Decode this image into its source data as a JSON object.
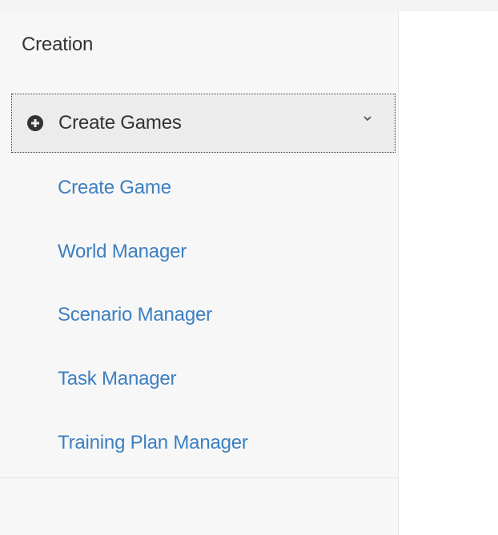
{
  "sidebar": {
    "section_title": "Creation",
    "group": {
      "label": "Create Games",
      "icon": "plus-circle-icon",
      "expand_icon": "chevron-down-icon"
    },
    "items": [
      {
        "label": "Create Game"
      },
      {
        "label": "World Manager"
      },
      {
        "label": "Scenario Manager"
      },
      {
        "label": "Task Manager"
      },
      {
        "label": "Training Plan Manager"
      }
    ]
  },
  "colors": {
    "link": "#3c7fc1",
    "text": "#333333",
    "sidebar_bg": "#f7f7f7",
    "active_bg": "#ececec"
  }
}
